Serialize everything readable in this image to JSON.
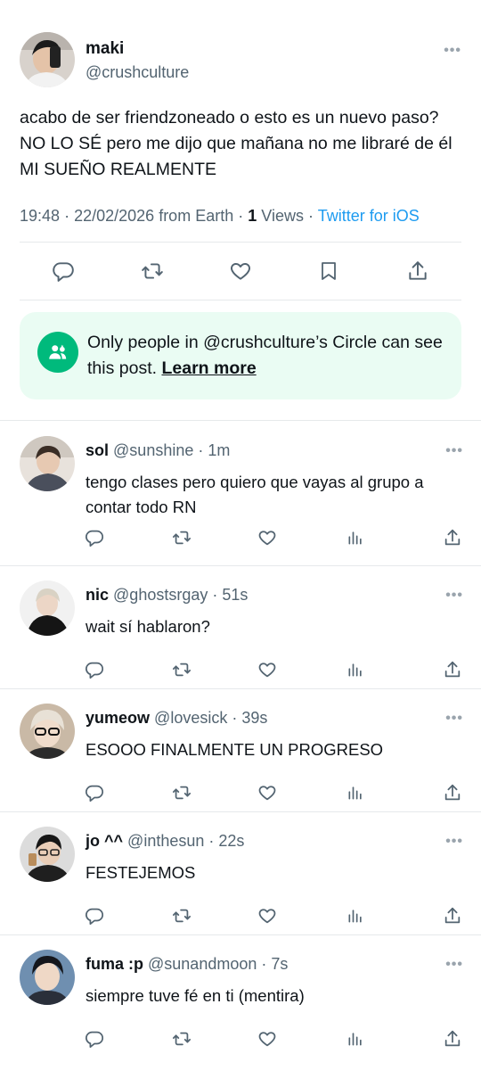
{
  "main_post": {
    "author_name": "maki",
    "author_handle": "@crushculture",
    "text": "acabo de ser friendzoneado o esto es un nuevo paso? NO LO SÉ pero me dijo que mañana no me libraré de él MI SUEÑO REALMENTE",
    "time": "19:48",
    "date": "22/02/2026",
    "location": "from Earth",
    "views_count": "1",
    "views_label": "Views",
    "client": "Twitter for iOS",
    "more_label": "•••"
  },
  "circle_notice": {
    "text": "Only people in @crushculture’s Circle can see this post.",
    "link": "Learn more"
  },
  "separator": "·",
  "replies": [
    {
      "name": "sol",
      "handle": "@sunshine",
      "time": "1m",
      "text": "tengo clases pero quiero que vayas al grupo a contar todo RN"
    },
    {
      "name": "nic",
      "handle": "@ghostsrgay",
      "time": "51s",
      "text": "wait sí hablaron?"
    },
    {
      "name": "yumeow",
      "handle": "@lovesick",
      "time": "39s",
      "text": "ESOOO FINALMENTE UN PROGRESO"
    },
    {
      "name": "jo ^^",
      "handle": "@inthesun",
      "time": "22s",
      "text": "FESTEJEMOS"
    },
    {
      "name": "fuma :p",
      "handle": "@sunandmoon",
      "time": "7s",
      "text": "siempre tuve fé en ti (mentira)"
    }
  ],
  "colors": {
    "accent": "#1d9bf0",
    "circle_green": "#00ba7c",
    "circle_bg": "#eafcf3",
    "secondary_text": "#536471"
  },
  "icons": [
    "reply-icon",
    "retweet-icon",
    "like-icon",
    "bookmark-icon",
    "views-icon",
    "share-icon",
    "circle-people-icon",
    "more-icon"
  ]
}
